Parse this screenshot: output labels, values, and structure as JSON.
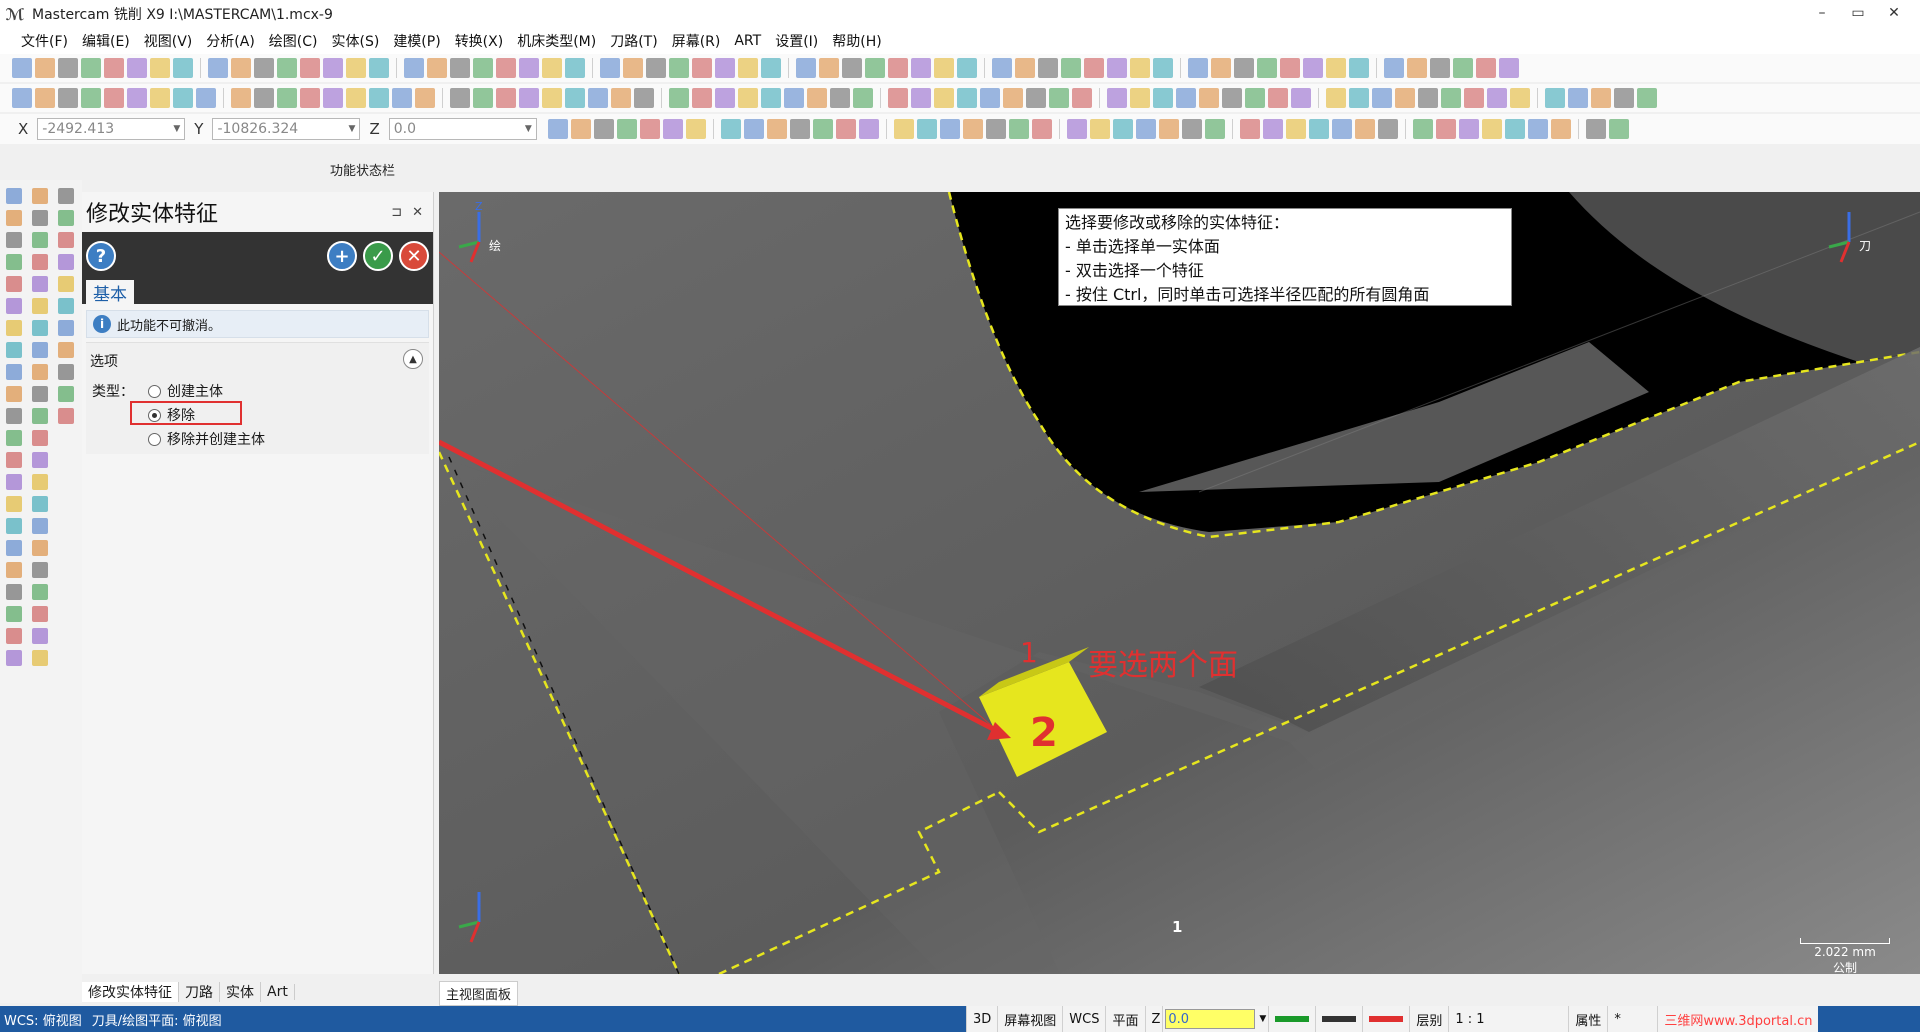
{
  "window": {
    "title": "Mastercam 铣削 X9  I:\\MASTERCAM\\1.mcx-9",
    "minimize": "–",
    "restore": "▭",
    "close": "✕"
  },
  "menu": [
    "文件(F)",
    "编辑(E)",
    "视图(V)",
    "分析(A)",
    "绘图(C)",
    "实体(S)",
    "建模(P)",
    "转换(X)",
    "机床类型(M)",
    "刀路(T)",
    "屏幕(R)",
    "ART",
    "设置(I)",
    "帮助(H)"
  ],
  "coords": {
    "x_label": "X",
    "x_value": "-2492.413",
    "y_label": "Y",
    "y_value": "-10826.324",
    "z_label": "Z",
    "z_value": "0.0"
  },
  "function_status_bar": "功能状态栏",
  "panel": {
    "title": "修改实体特征",
    "pin": "⊐",
    "close": "✕",
    "help": "?",
    "ok_plus": "+",
    "ok": "✓",
    "cancel": "✕",
    "tab": "基本",
    "info": "此功能不可撤消。",
    "section_title": "选项",
    "type_label": "类型：",
    "options": [
      "创建主体",
      "移除",
      "移除并创建主体"
    ],
    "selected_option": "移除"
  },
  "panel_tabs": [
    "修改实体特征",
    "刀路",
    "实体",
    "Art"
  ],
  "viewport": {
    "tooltip_lines": [
      "选择要修改或移除的实体特征：",
      "- 单击选择单一实体面",
      "- 双击选择一个特征",
      "- 按住 Ctrl，同时单击可选择半径匹配的所有圆角面"
    ],
    "annotation": "要选两个面",
    "annotation_1": "1",
    "annotation_2": "2",
    "view_number": "1",
    "scale_value": "2.022 mm",
    "scale_unit": "公制",
    "axis_gnomon_label": "绘",
    "axis_tool_label": "刀",
    "axis_x": "X",
    "axis_y": "Y",
    "axis_z": "Z"
  },
  "view_tab": "主视图面板",
  "status": {
    "wcs": "WCS: 俯视图",
    "tool_plane": "刀具/绘图平面: 俯视图",
    "mode_3d": "3D",
    "screen_view": "屏幕视图",
    "wcs_btn": "WCS",
    "plane": "平面",
    "z_label": "Z",
    "z_value": "0.0",
    "layer": "层别",
    "layer_value": "1 : 1",
    "attr": "属性",
    "attr_value": "*",
    "watermark": "三维网www.3dportal.cn"
  },
  "colors": {
    "selected_face": "#e6e61e",
    "annotation": "#e03030",
    "statusbar": "#1f5aa0"
  }
}
